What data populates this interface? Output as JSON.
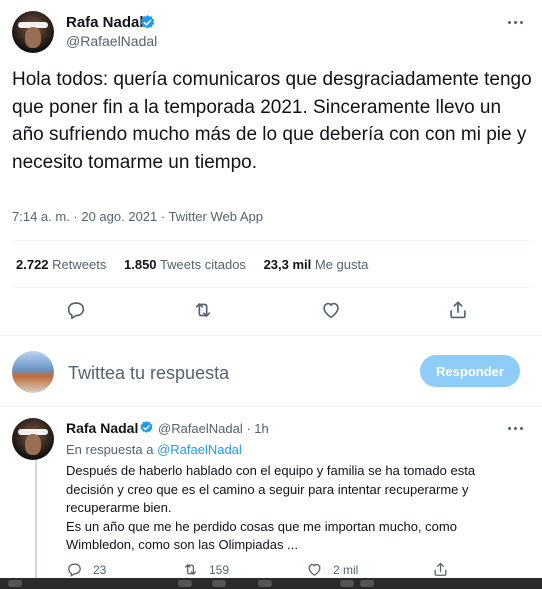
{
  "main_tweet": {
    "author_name": "Rafa Nadal",
    "handle": "@RafaelNadal",
    "text": "Hola todos: quería comunicaros que desgraciadamente tengo que poner fin a la temporada 2021. Sinceramente llevo un año sufriendo mucho más de lo que debería con con mi pie y necesito tomarme un tiempo.",
    "meta": "7:14 a. m. · 20 ago. 2021 · Twitter Web App",
    "stats": {
      "retweets_count": "2.722",
      "retweets_label": "Retweets",
      "quotes_count": "1.850",
      "quotes_label": "Tweets citados",
      "likes_count": "23,3 mil",
      "likes_label": "Me gusta"
    }
  },
  "reply_composer": {
    "placeholder": "Twittea tu respuesta",
    "button_label": "Responder"
  },
  "reply_tweet": {
    "author_name": "Rafa Nadal",
    "handle_time": "@RafaelNadal · 1h",
    "reply_prefix": "En respuesta a ",
    "reply_to": "@RafaelNadal",
    "text_line1": "Después de haberlo hablado con el equipo y familia se ha tomado esta decisión y creo que es el camino a seguir para intentar recuperarme y recuperarme bien.",
    "text_line2": "Es un año que me he perdido cosas que me importan mucho, como Wimbledon, como son las Olimpiadas ...",
    "replies": "23",
    "retweets": "159",
    "likes": "2 mil"
  },
  "colors": {
    "accent": "#1d9bf0",
    "button_disabled": "#8ecdf8",
    "secondary_text": "#536471"
  },
  "icons": [
    "verified-badge-icon",
    "more-icon",
    "reply-icon",
    "retweet-icon",
    "like-icon",
    "share-icon"
  ]
}
